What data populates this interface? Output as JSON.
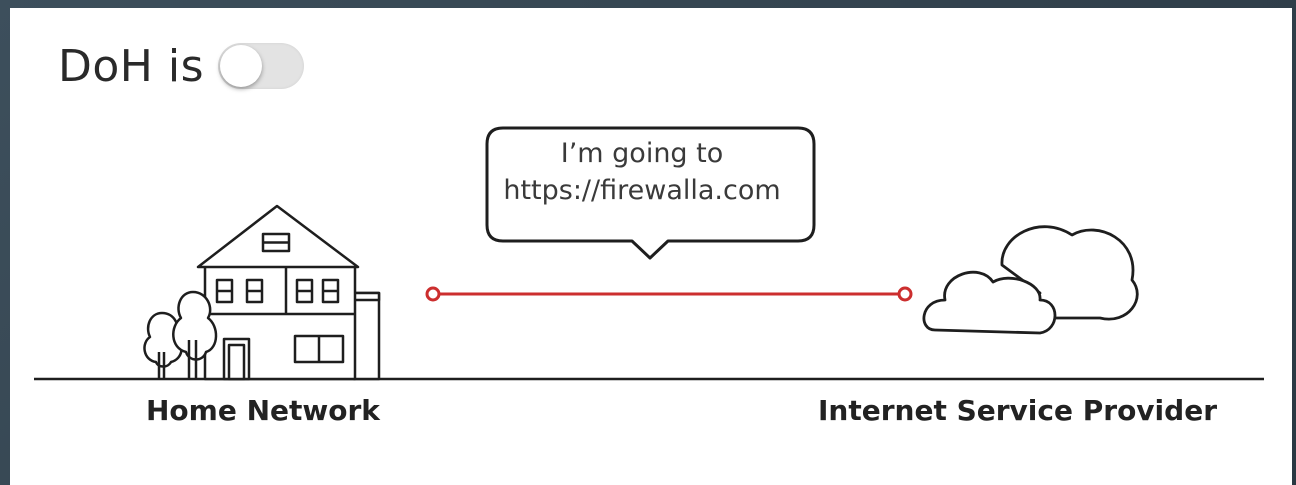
{
  "header": {
    "label": "DoH is",
    "toggle_state": "off"
  },
  "bubble": {
    "line1": "I’m going to",
    "line2": "https://firewalla.com"
  },
  "labels": {
    "home": "Home Network",
    "isp": "Internet Service Provider"
  },
  "colors": {
    "connection_line": "#cc2e2e",
    "toggle_off": "#e3e3e3"
  },
  "icons": [
    "house-icon",
    "trees-icon",
    "cloud-icon",
    "speech-bubble"
  ]
}
